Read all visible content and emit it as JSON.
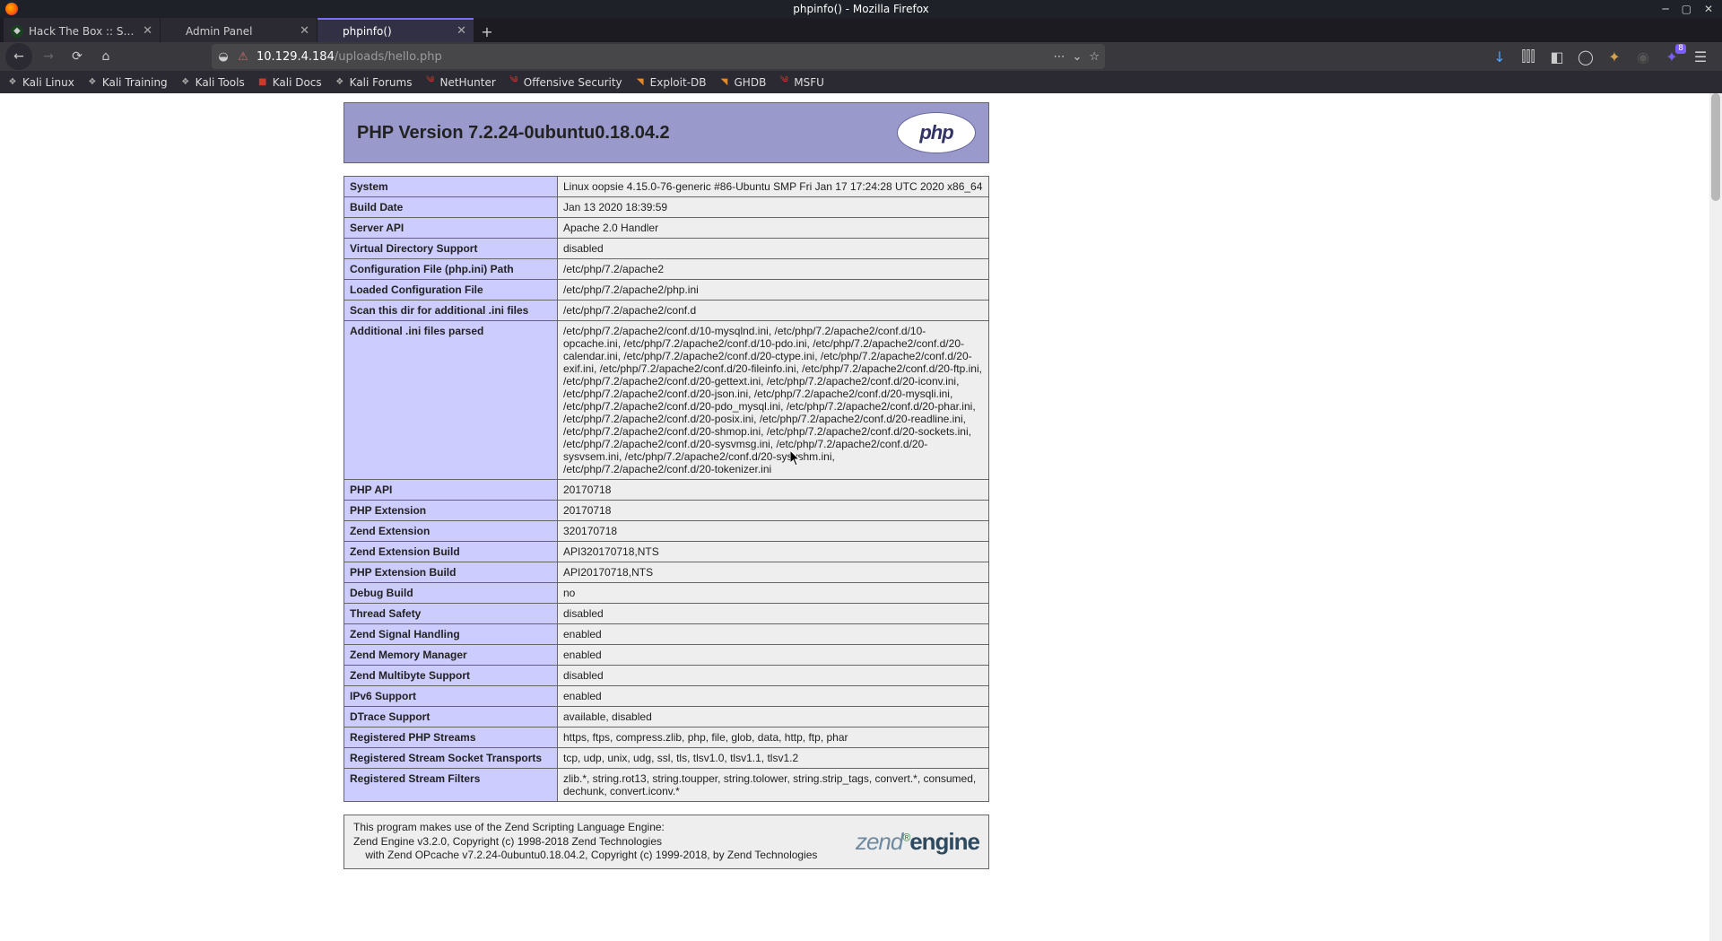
{
  "os": {
    "title": "phpinfo() - Mozilla Firefox"
  },
  "tabs": [
    {
      "label": "Hack The Box :: Starting P",
      "active": false,
      "favicon": "htb"
    },
    {
      "label": "Admin Panel",
      "active": false,
      "favicon": ""
    },
    {
      "label": "phpinfo()",
      "active": true,
      "favicon": ""
    }
  ],
  "url": {
    "host": "10.129.4.184",
    "path": "/uploads/hello.php"
  },
  "bookmarks": [
    {
      "label": "Kali Linux",
      "icon": "kali"
    },
    {
      "label": "Kali Training",
      "icon": "kali"
    },
    {
      "label": "Kali Tools",
      "icon": "kali"
    },
    {
      "label": "Kali Docs",
      "icon": "red"
    },
    {
      "label": "Kali Forums",
      "icon": "kali"
    },
    {
      "label": "NetHunter",
      "icon": "dragon"
    },
    {
      "label": "Offensive Security",
      "icon": "dragon"
    },
    {
      "label": "Exploit-DB",
      "icon": "orange"
    },
    {
      "label": "GHDB",
      "icon": "orange"
    },
    {
      "label": "MSFU",
      "icon": "dragon"
    }
  ],
  "php": {
    "title": "PHP Version 7.2.24-0ubuntu0.18.04.2",
    "rows": [
      {
        "k": "System",
        "v": "Linux oopsie 4.15.0-76-generic #86-Ubuntu SMP Fri Jan 17 17:24:28 UTC 2020 x86_64"
      },
      {
        "k": "Build Date",
        "v": "Jan 13 2020 18:39:59"
      },
      {
        "k": "Server API",
        "v": "Apache 2.0 Handler"
      },
      {
        "k": "Virtual Directory Support",
        "v": "disabled"
      },
      {
        "k": "Configuration File (php.ini) Path",
        "v": "/etc/php/7.2/apache2"
      },
      {
        "k": "Loaded Configuration File",
        "v": "/etc/php/7.2/apache2/php.ini"
      },
      {
        "k": "Scan this dir for additional .ini files",
        "v": "/etc/php/7.2/apache2/conf.d"
      },
      {
        "k": "Additional .ini files parsed",
        "v": "/etc/php/7.2/apache2/conf.d/10-mysqlnd.ini, /etc/php/7.2/apache2/conf.d/10-opcache.ini, /etc/php/7.2/apache2/conf.d/10-pdo.ini, /etc/php/7.2/apache2/conf.d/20-calendar.ini, /etc/php/7.2/apache2/conf.d/20-ctype.ini, /etc/php/7.2/apache2/conf.d/20-exif.ini, /etc/php/7.2/apache2/conf.d/20-fileinfo.ini, /etc/php/7.2/apache2/conf.d/20-ftp.ini, /etc/php/7.2/apache2/conf.d/20-gettext.ini, /etc/php/7.2/apache2/conf.d/20-iconv.ini, /etc/php/7.2/apache2/conf.d/20-json.ini, /etc/php/7.2/apache2/conf.d/20-mysqli.ini, /etc/php/7.2/apache2/conf.d/20-pdo_mysql.ini, /etc/php/7.2/apache2/conf.d/20-phar.ini, /etc/php/7.2/apache2/conf.d/20-posix.ini, /etc/php/7.2/apache2/conf.d/20-readline.ini, /etc/php/7.2/apache2/conf.d/20-shmop.ini, /etc/php/7.2/apache2/conf.d/20-sockets.ini, /etc/php/7.2/apache2/conf.d/20-sysvmsg.ini, /etc/php/7.2/apache2/conf.d/20-sysvsem.ini, /etc/php/7.2/apache2/conf.d/20-sysvshm.ini, /etc/php/7.2/apache2/conf.d/20-tokenizer.ini"
      },
      {
        "k": "PHP API",
        "v": "20170718"
      },
      {
        "k": "PHP Extension",
        "v": "20170718"
      },
      {
        "k": "Zend Extension",
        "v": "320170718"
      },
      {
        "k": "Zend Extension Build",
        "v": "API320170718,NTS"
      },
      {
        "k": "PHP Extension Build",
        "v": "API20170718,NTS"
      },
      {
        "k": "Debug Build",
        "v": "no"
      },
      {
        "k": "Thread Safety",
        "v": "disabled"
      },
      {
        "k": "Zend Signal Handling",
        "v": "enabled"
      },
      {
        "k": "Zend Memory Manager",
        "v": "enabled"
      },
      {
        "k": "Zend Multibyte Support",
        "v": "disabled"
      },
      {
        "k": "IPv6 Support",
        "v": "enabled"
      },
      {
        "k": "DTrace Support",
        "v": "available, disabled"
      },
      {
        "k": "Registered PHP Streams",
        "v": "https, ftps, compress.zlib, php, file, glob, data, http, ftp, phar"
      },
      {
        "k": "Registered Stream Socket Transports",
        "v": "tcp, udp, unix, udg, ssl, tls, tlsv1.0, tlsv1.1, tlsv1.2"
      },
      {
        "k": "Registered Stream Filters",
        "v": "zlib.*, string.rot13, string.toupper, string.tolower, string.strip_tags, convert.*, consumed, dechunk, convert.iconv.*"
      }
    ],
    "zend": {
      "line1": "This program makes use of the Zend Scripting Language Engine:",
      "line2": "Zend Engine v3.2.0, Copyright (c) 1998-2018 Zend Technologies",
      "line3": "    with Zend OPcache v7.2.24-0ubuntu0.18.04.2, Copyright (c) 1999-2018, by Zend Technologies"
    }
  }
}
